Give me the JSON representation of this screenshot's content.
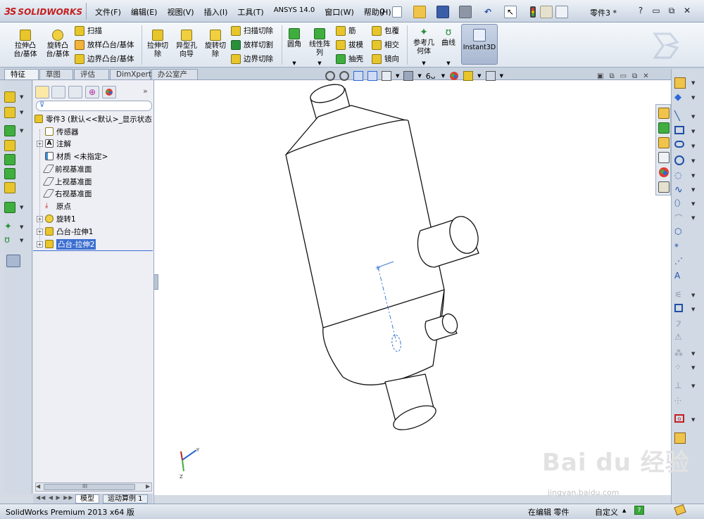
{
  "app": {
    "logo_text": "SOLIDWORKS",
    "logo_mark": "3S",
    "document_title": "零件3 *",
    "watermark": "jingyan.baidu.com",
    "watermark_logo": "Bai du 经验"
  },
  "menu": [
    "文件(F)",
    "编辑(E)",
    "视图(V)",
    "插入(I)",
    "工具(T)",
    "ANSYS 14.0",
    "窗口(W)",
    "帮助(H)"
  ],
  "ribbon": {
    "extrude_boss": "拉伸凸\n台/基体",
    "revolve_boss": "旋转凸\n台/基体",
    "sweep": "扫描",
    "loft": "放样凸台/基体",
    "boundary_boss": "边界凸台/基体",
    "extrude_cut": "拉伸切\n除",
    "hole_wizard": "异型孔\n向导",
    "revolve_cut": "旋转切\n除",
    "swept_cut": "扫描切除",
    "lofted_cut": "放样切割",
    "boundary_cut": "边界切除",
    "fillet": "圆角",
    "linear_pattern": "线性阵\n列",
    "rib": "筋",
    "draft": "拔模",
    "shell": "抽壳",
    "wrap": "包覆",
    "intersect": "相交",
    "mirror": "镜向",
    "reference_geometry": "参考几\n何体",
    "curves": "曲线",
    "instant3d": "Instant3D"
  },
  "tabs": [
    "特征",
    "草图",
    "评估",
    "DimXpert",
    "办公室产品"
  ],
  "tree": {
    "root": "零件3  (默认<<默认>_显示状态",
    "items": [
      {
        "label": "传感器",
        "expandable": false
      },
      {
        "label": "注解",
        "expandable": true
      },
      {
        "label": "材质 <未指定>",
        "expandable": false
      },
      {
        "label": "前视基准面",
        "expandable": false
      },
      {
        "label": "上视基准面",
        "expandable": false
      },
      {
        "label": "右视基准面",
        "expandable": false
      },
      {
        "label": "原点",
        "expandable": false
      },
      {
        "label": "旋转1",
        "expandable": true
      },
      {
        "label": "凸台-拉伸1",
        "expandable": true
      },
      {
        "label": "凸台-拉伸2",
        "expandable": true,
        "selected": true
      }
    ],
    "hscroll_label": "III"
  },
  "bottom_tabs": [
    "模型",
    "运动算例 1"
  ],
  "status": {
    "left": "SolidWorks Premium 2013 x64 版",
    "editing": "在编辑 零件",
    "custom": "自定义",
    "help": "?"
  },
  "colors": {
    "accent": "#3c6fd1",
    "brand": "#c41f1f",
    "chrome": "#d4dbe4"
  }
}
